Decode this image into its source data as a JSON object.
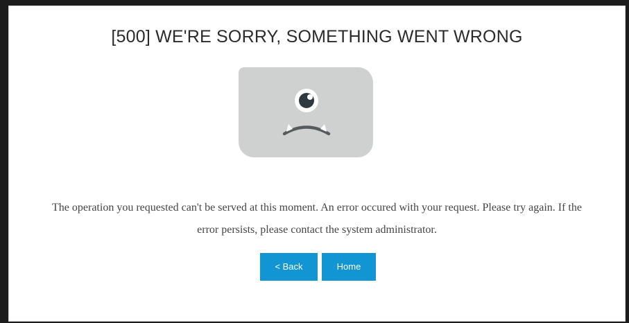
{
  "page": {
    "title": "[500] WE'RE SORRY, SOMETHING WENT WRONG",
    "message": "The operation you requested can't be served at this moment. An error occured with your request. Please try again. If the error persists, please contact the system administrator."
  },
  "illustration": {
    "icon": "sad-cyclops-monster-icon"
  },
  "buttons": {
    "back_label": "< Back",
    "home_label": "Home"
  },
  "colors": {
    "button": "#1195d3",
    "illustration_bg": "#cfd1d1",
    "face": "#2f3a40"
  }
}
